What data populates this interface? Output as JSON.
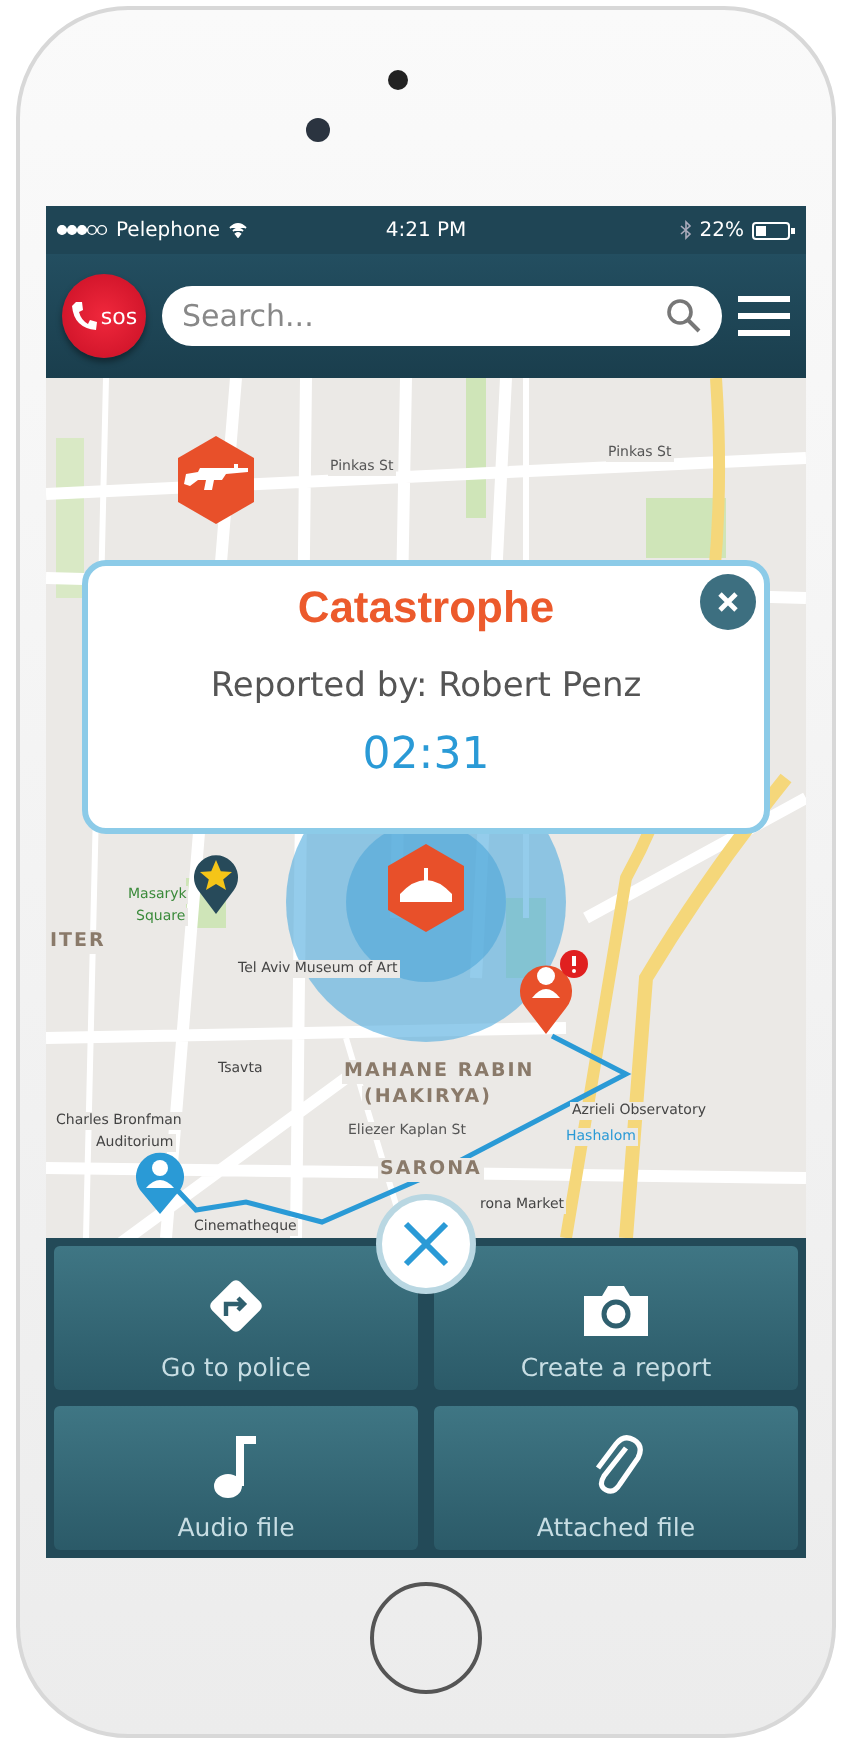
{
  "status_bar": {
    "carrier": "Pelephone",
    "time": "4:21 PM",
    "battery": "22%"
  },
  "header": {
    "sos_label": "sos",
    "search": {
      "placeholder": "Search..."
    }
  },
  "map": {
    "labels": [
      {
        "text": "Pinkas St",
        "kind": "street"
      },
      {
        "text": "Pinkas St",
        "kind": "street"
      },
      {
        "text": "Masaryk",
        "kind": "place"
      },
      {
        "text": "Square",
        "kind": "place"
      },
      {
        "text": "ITER",
        "kind": "district"
      },
      {
        "text": "Tel Aviv Museum of Art",
        "kind": "poi"
      },
      {
        "text": "Tsavta",
        "kind": "poi"
      },
      {
        "text": "MAHANE RABIN",
        "kind": "district"
      },
      {
        "text": "(HAKIRYA)",
        "kind": "district"
      },
      {
        "text": "Charles Bronfman",
        "kind": "poi"
      },
      {
        "text": "Auditorium",
        "kind": "poi"
      },
      {
        "text": "Eliezer Kaplan St",
        "kind": "street"
      },
      {
        "text": "SARONA",
        "kind": "district"
      },
      {
        "text": "Azrieli Observatory",
        "kind": "poi"
      },
      {
        "text": "Hashalom",
        "kind": "transit"
      },
      {
        "text": "rona Market",
        "kind": "poi"
      },
      {
        "text": "Cinematheque",
        "kind": "poi"
      }
    ]
  },
  "alert": {
    "title": "Catastrophe",
    "reported_by": "Reported by: Robert Penz",
    "timer": "02:31"
  },
  "actions": [
    {
      "label": "Go to police",
      "kind": "directions"
    },
    {
      "label": "Create a report",
      "kind": "camera"
    },
    {
      "label": "Audio file",
      "kind": "audio"
    },
    {
      "label": "Attached file",
      "kind": "attachment"
    }
  ]
}
